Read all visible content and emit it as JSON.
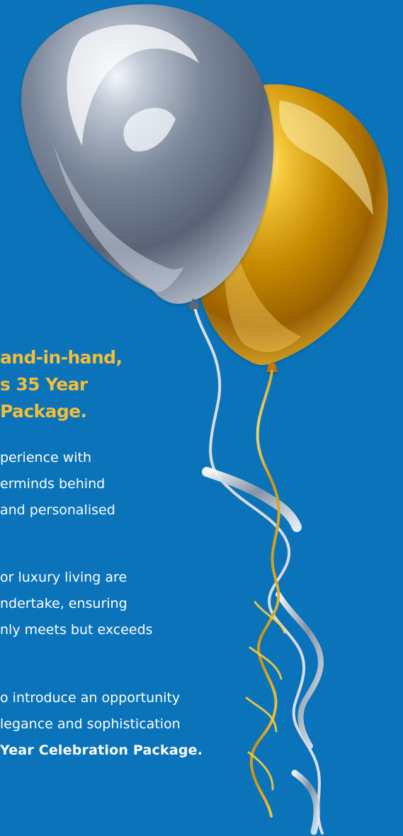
{
  "headline": {
    "lines": [
      "and-in-hand,",
      "s 35 Year",
      "Package."
    ]
  },
  "paragraphs": [
    {
      "lines": [
        "perience with",
        "erminds behind",
        "and personalised"
      ]
    },
    {
      "lines": [
        "or luxury living are",
        "ndertake, ensuring",
        "nly meets but exceeds"
      ]
    },
    {
      "lines": [
        "o introduce an opportunity",
        "legance and sophistication"
      ],
      "strong_line": "Year Celebration Package."
    }
  ],
  "colors": {
    "background": "#0a73b9",
    "headline": "#f2bd3a",
    "body": "#ffffff",
    "silver_balloon": "#8b97a8",
    "gold_balloon": "#d99a08"
  },
  "decorations": {
    "silver_balloon": "silver-balloon",
    "gold_balloon": "gold-balloon",
    "ribbons": "curled-ribbons"
  }
}
